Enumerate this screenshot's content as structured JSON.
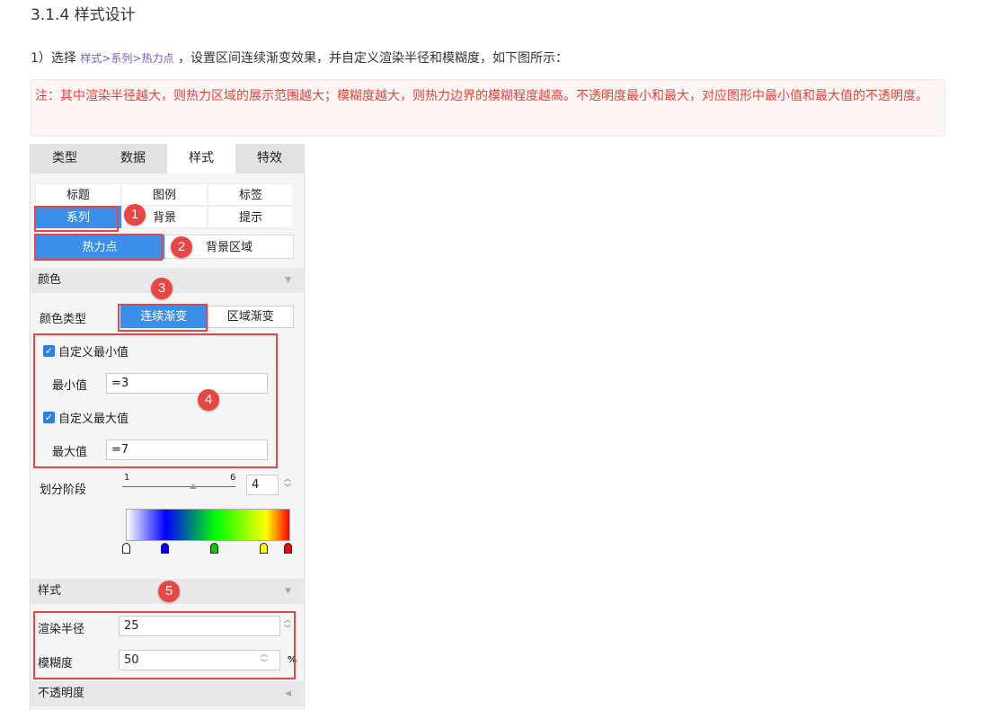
{
  "doc": {
    "heading": "3.1.4 样式设计",
    "step_prefix": "1）选择",
    "step_path": "样式>系列>热力点",
    "step_suffix": "，设置区间连续渐变效果，并自定义渲染半径和模糊度，如下图所示：",
    "note": "注：其中渲染半径越大，则热力区域的展示范围越大；模糊度越大，则热力边界的模糊程度越高。不透明度最小和最大，对应图形中最小值和最大值的不透明度。"
  },
  "panel": {
    "tabs": [
      "类型",
      "数据",
      "样式",
      "特效"
    ],
    "subtabs": [
      "标题",
      "图例",
      "标签",
      "系列",
      "背景",
      "提示"
    ],
    "series_options": [
      "热力点",
      "背景区域"
    ],
    "color_section": "颜色",
    "color_type_label": "颜色类型",
    "color_type_options": [
      "连续渐变",
      "区域渐变"
    ],
    "custom_min_label": "自定义最小值",
    "min_label": "最小值",
    "min_value": "=3",
    "custom_max_label": "自定义最大值",
    "max_label": "最大值",
    "max_value": "=7",
    "stage_label": "划分阶段",
    "stage_min": "1",
    "stage_max": "6",
    "stage_value": "4",
    "style_section": "样式",
    "radius_label": "渲染半径",
    "radius_value": "25",
    "blur_label": "模糊度",
    "blur_value": "50",
    "blur_unit": "%",
    "opacity_section": "不透明度",
    "gradient_stop_colors": [
      "#ffffff",
      "#0000ff",
      "#00cc00",
      "#ffff00",
      "#ff0000"
    ]
  },
  "annotations": [
    "1",
    "2",
    "3",
    "4",
    "5"
  ],
  "colors": {
    "accent": "#3b8fe8",
    "highlight": "#e84545",
    "note_text": "#e8443c",
    "path_link": "#7a59c8"
  }
}
